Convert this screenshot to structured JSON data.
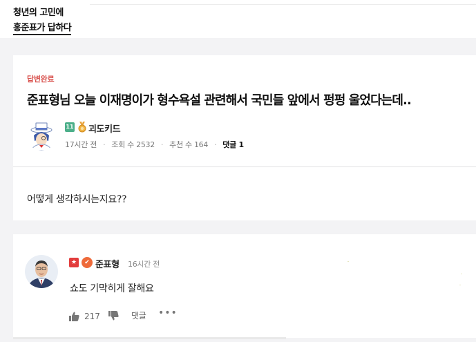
{
  "header": {
    "brand_line1": "청년의 고민에",
    "brand_line2": "홍준표가 답하다"
  },
  "post": {
    "status": "답변완료",
    "title": "준표형님 오늘 이재명이가 형수욕설 관련해서 국민들 앞에서 펑펑 울었다는데..",
    "author": {
      "name": "괴도키드",
      "level_badge": "11"
    },
    "meta": {
      "time": "17시간 전",
      "views": "조회 수 2532",
      "recommends": "추천 수 164",
      "comments": "댓글 1"
    },
    "body": "어떻게 생각하시는지요??"
  },
  "answer": {
    "author": "준표형",
    "time": "16시간 전",
    "text": "쇼도 기막히게 잘해요",
    "likes": "217",
    "reply_label": "댓글",
    "more_label": "•••"
  },
  "icons": [
    "medal-icon",
    "thumbs-up-icon",
    "thumbs-down-icon",
    "more-dots-icon",
    "flag-badge-icon",
    "party-badge-icon"
  ],
  "colors": {
    "status_red": "#d9534f",
    "level_green": "#4caf8a",
    "flag_red": "#e23c3c",
    "party_orange": "#ee6a3a"
  }
}
